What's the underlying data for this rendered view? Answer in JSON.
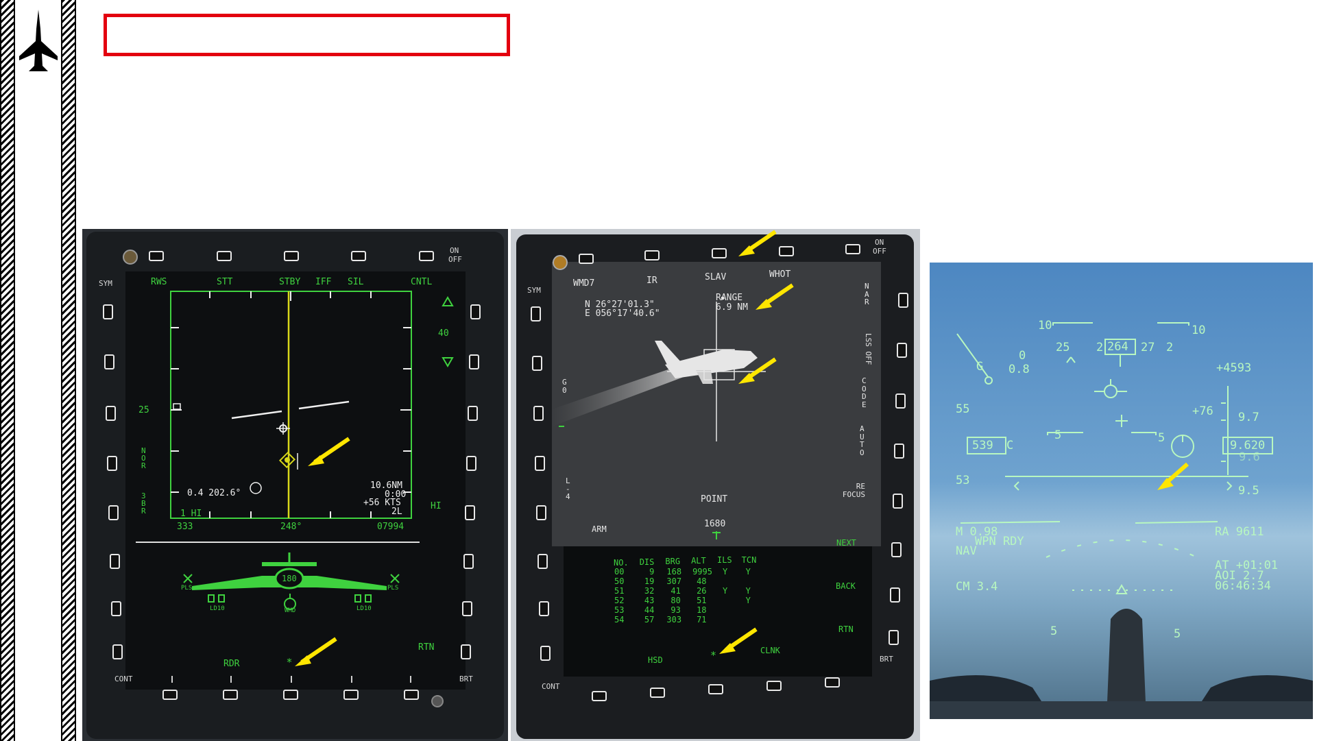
{
  "page": {
    "title": ""
  },
  "left_mfd": {
    "top_labels": [
      "RWS",
      "STT",
      "STBY",
      "IFF",
      "SIL",
      "CNTL"
    ],
    "sym": "SYM",
    "on_off": [
      "ON",
      "OFF"
    ],
    "range_value": "40",
    "left_side": [
      "25",
      "N",
      "O",
      "R",
      "3",
      "B",
      "R"
    ],
    "right_side": [
      "HI",
      "RTN"
    ],
    "target_info": "0.4 202.6°",
    "range_readout": "10.6NM",
    "time_readout": "0:00",
    "closure_readout": "+56 KTS",
    "l_readout": "2L",
    "bottom_left": "1 HI",
    "scale_left": "333",
    "scale_mid": "248°",
    "scale_right": "07994",
    "stores": [
      "PLS",
      "LD10",
      "WMD",
      "LD10",
      "PLS"
    ],
    "gun_rounds": "180",
    "bottom_labels": [
      "RDR",
      "CONT",
      "BRT"
    ]
  },
  "mid_mfd": {
    "top_labels": [
      "WMD7",
      "IR",
      "SLAV",
      "WHOT"
    ],
    "sym": "SYM",
    "on_off": [
      "ON",
      "OFF"
    ],
    "coord_n": "N  26°27'01.3\"",
    "coord_e": "E 056°17'40.6\"",
    "range_label": "RANGE",
    "range_value": "6.9 NM",
    "right_labels": [
      "NAR",
      "LSS OFF",
      "CODE",
      "AUTO",
      "RE FOCUS"
    ],
    "left_labels": [
      "G 0",
      "L -4",
      "ARM"
    ],
    "point_label": "POINT",
    "value_1680": "1680",
    "table": {
      "headers": [
        "NO.",
        "DIS",
        "BRG",
        "ALT",
        "ILS",
        "TCN"
      ],
      "rows": [
        [
          "00",
          "9",
          "168",
          "9995",
          "Y",
          "Y"
        ],
        [
          "50",
          "19",
          "307",
          "48",
          "",
          ""
        ],
        [
          "51",
          "32",
          "41",
          "26",
          "Y",
          "Y"
        ],
        [
          "52",
          "43",
          "80",
          "51",
          "",
          "Y"
        ],
        [
          "53",
          "44",
          "93",
          "18",
          "",
          ""
        ],
        [
          "54",
          "57",
          "303",
          "71",
          "",
          ""
        ]
      ]
    },
    "side_labels": [
      "NEXT",
      "BACK",
      "RTN"
    ],
    "bottom_labels": [
      "HSD",
      "CLNK",
      "CONT",
      "BRT"
    ]
  },
  "hud": {
    "pitch_top": [
      "10",
      "10"
    ],
    "heading": [
      "25",
      "2",
      "264",
      "27",
      "2"
    ],
    "g_readout": "G",
    "alpha_readout": "0.8",
    "zero": "0",
    "altitude_top": "+4593",
    "speed_scale": [
      "55",
      "53"
    ],
    "speed_box": "539",
    "speed_c": "C",
    "vvi": "+76",
    "alt_scale": [
      "9.7",
      "9.6",
      "9.5"
    ],
    "alt_box": "9.620",
    "pitch_5": [
      "5",
      "5"
    ],
    "mach": "M 0.98",
    "wpn": "WPN RDY",
    "nav": "NAV",
    "cm": "CM 3.4",
    "radar_alt": "RA  9611",
    "at": "AT +01:01",
    "aoi": "AOI 2.7",
    "time": "06:46:34",
    "bottom_pitch": [
      "5",
      "5"
    ]
  },
  "colors": {
    "mfd_green": "#3fd23f",
    "hud_green": "#b8f7c0",
    "arrow": "#ffe600",
    "title_box": "#e3000f"
  }
}
